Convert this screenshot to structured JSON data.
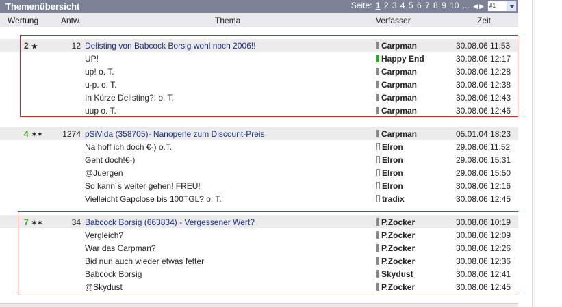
{
  "header": {
    "title": "Themenübersicht",
    "pager_label": "Seite:",
    "pages": [
      "1",
      "2",
      "3",
      "4",
      "5",
      "6",
      "7",
      "8",
      "9",
      "10"
    ],
    "ellipsis": "...",
    "page_select_value": "#1"
  },
  "columns": {
    "rating": "Wertung",
    "answers": "Antw.",
    "topic": "Thema",
    "author": "Verfasser",
    "time": "Zeit"
  },
  "threads": [
    {
      "rating": "2",
      "answers": "12",
      "title": "Delisting von Babcock Borsig wohl noch 2006!!",
      "author": "Carpman",
      "time": "30.08.06 11:53",
      "replies": [
        {
          "title": "UP!",
          "author": "Happy End",
          "time": "30.08.06 12:17"
        },
        {
          "title": "up! o. T.",
          "author": "Carpman",
          "time": "30.08.06 12:28"
        },
        {
          "title": "u-p. o. T.",
          "author": "Carpman",
          "time": "30.08.06 12:38"
        },
        {
          "title": "In Kürze Delisting?! o. T.",
          "author": "Carpman",
          "time": "30.08.06 12:43"
        },
        {
          "title": "uup o. T.",
          "author": "Carpman",
          "time": "30.08.06 12:46"
        }
      ]
    },
    {
      "rating": "4",
      "answers": "1274",
      "title": "pSiVida (358705)- Nanoperle zum Discount-Preis",
      "author": "Carpman",
      "time": "05.01.04 18:23",
      "replies": [
        {
          "title": "Na hoff ich doch €-) o.T.",
          "author": "Elron",
          "time": "29.08.06 11:52"
        },
        {
          "title": "Geht doch!€-)",
          "author": "Elron",
          "time": "29.08.06 15:31"
        },
        {
          "title": "@Juergen",
          "author": "Elron",
          "time": "29.08.06 15:50"
        },
        {
          "title": "So kann´s weiter gehen! FREU!",
          "author": "Elron",
          "time": "30.08.06 12:16"
        },
        {
          "title": "Vielleicht Gapclose bis 100TGL? o. T.",
          "author": "tradix",
          "time": "30.08.06 12:45"
        }
      ]
    },
    {
      "rating": "7",
      "answers": "34",
      "title": "Babcock Borsig (663834) - Vergessener Wert?",
      "author": "P.Zocker",
      "time": "30.08.06 10:19",
      "replies": [
        {
          "title": "Vergleich?",
          "author": "P.Zocker",
          "time": "30.08.06 12:09"
        },
        {
          "title": "War das Carpman?",
          "author": "P.Zocker",
          "time": "30.08.06 12:26"
        },
        {
          "title": "Bid nun auch wieder etwas fetter",
          "author": "P.Zocker",
          "time": "30.08.06 12:36"
        },
        {
          "title": "Babcock Borsig",
          "author": "Skydust",
          "time": "30.08.06 12:41"
        },
        {
          "title": "@Skydust",
          "author": "P.Zocker",
          "time": "30.08.06 12:45"
        }
      ]
    }
  ],
  "colors": {
    "titlebar": "#7c8196",
    "link": "#1a2f8a",
    "highlight_box": "#cc2a2a",
    "rating_green": "#3a9a1a"
  }
}
